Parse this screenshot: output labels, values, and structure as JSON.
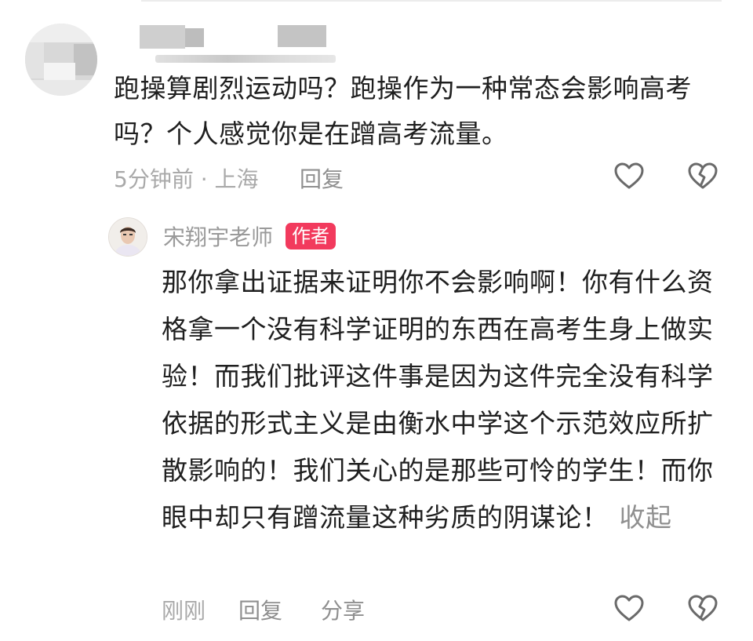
{
  "comment": {
    "text": "跑操算剧烈运动吗？跑操作为一种常态会影响高考吗？个人感觉你是在蹭高考流量。",
    "time_location": "5分钟前 · 上海",
    "reply_label": "回复"
  },
  "author_reply": {
    "author_name": "宋翔宇老师",
    "author_badge": "作者",
    "text": "那你拿出证据来证明你不会影响啊！你有什么资格拿一个没有科学证明的东西在高考生身上做实验！而我们批评这件事是因为这件完全没有科学依据的形式主义是由衡水中学这个示范效应所扩散影响的！我们关心的是那些可怜的学生！而你眼中却只有蹭流量这种劣质的阴谋论！",
    "collapse_label": "收起",
    "time": "刚刚",
    "reply_label": "回复",
    "share_label": "分享"
  },
  "icons": {
    "like": "heart-outline-icon",
    "dislike": "broken-heart-outline-icon"
  },
  "colors": {
    "author_badge_bg": "#f23a5d",
    "meta_text": "#a9a9a9",
    "body_text": "#1f1f1f"
  }
}
